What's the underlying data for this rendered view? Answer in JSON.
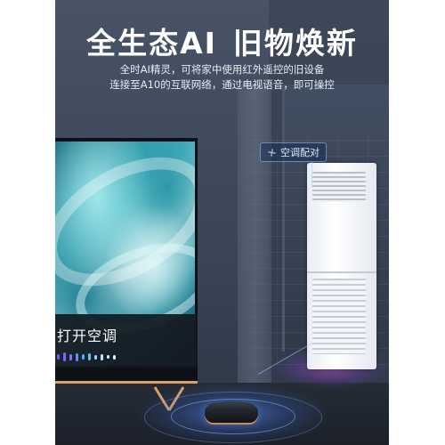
{
  "headline": {
    "left": "全生态AI",
    "right": "旧物焕新"
  },
  "subtext": {
    "line1": "全时AI精灵，可将家中使用红外遥控的旧设备",
    "line2": "连接至A10的互联网络，通过电视语音，即可操控"
  },
  "pair_tag": {
    "icon": "fan-icon",
    "label": "空调配对"
  },
  "tv": {
    "voice_command": "打开空调"
  },
  "colors": {
    "accent_blue": "#5a96ff",
    "glow_purple": "#be50d2",
    "stand_copper": "#d9a066"
  }
}
